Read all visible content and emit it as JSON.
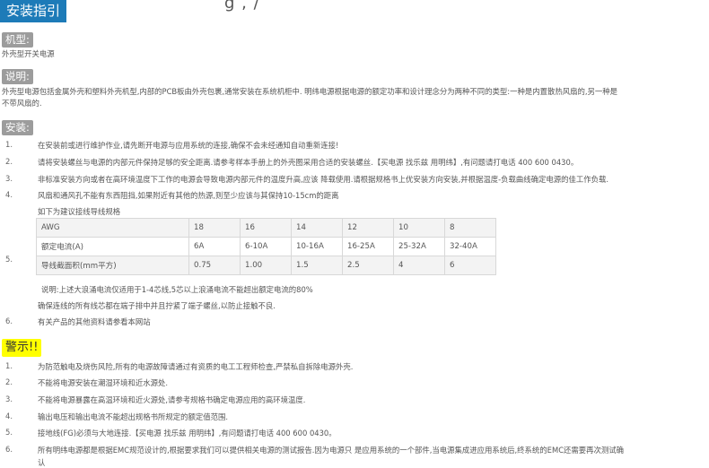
{
  "header": {
    "title": "安装指引",
    "top_clip": "g ,  /"
  },
  "model": {
    "label": "机型:",
    "value": "外壳型开关电源"
  },
  "description": {
    "label": "说明:",
    "line1": "外壳型电源包括金属外壳和塑料外壳机型,内部的PCB板由外壳包裹,通常安装在系统机柜中. 明纬电源根据电源的额定功率和设计理念分为两种不同的类型:一种是内置散热风扇的,另一种是",
    "line2": "不带风扇的."
  },
  "install": {
    "label": "安装:",
    "items": [
      {
        "num": "1.",
        "text": "在安装前或进行维护作业,请先断开电源与应用系统的连接,确保不会未经通知自动重新连接!"
      },
      {
        "num": "2.",
        "text": "请将安装螺丝与电源的内部元件保持足够的安全距离.请参考样本手册上的外壳图采用合适的安装螺丝.【买电源 找乐兹 用明纬】,有问题请打电话 400 600 0430。"
      },
      {
        "num": "3.",
        "text": "非标准安装方向或者在高环境温度下工作的电源会导致电源内部元件的温度升高,应该 降载使用.请根据规格书上优安装方向安装,并根据温度-负载曲线确定电源的佳工作负载."
      },
      {
        "num": "4.",
        "text": "风扇和通风孔不能有东西阻挡,如果附近有其他的热源,则至少应该与其保持10-15cm的距离"
      }
    ],
    "item5": {
      "num": "5.",
      "intro": "如下为建议接线导线规格",
      "note": "说明:上述大浪涌电流仅适用于1-4芯线,5芯以上浪涌电流不能超出额定电流的80%",
      "confirm": "确保连线的所有线芯都在端子排中并且拧紧了端子螺丝,以防止接触不良."
    },
    "table": {
      "rows": [
        [
          "AWG",
          "18",
          "16",
          "14",
          "12",
          "10",
          "8"
        ],
        [
          "额定电流(A)",
          "6A",
          "6-10A",
          "10-16A",
          "16-25A",
          "25-32A",
          "32-40A"
        ],
        [
          "导线截面积(mm平方)",
          "0.75",
          "1.00",
          "1.5",
          "2.5",
          "4",
          "6"
        ]
      ]
    },
    "item6": {
      "num": "6.",
      "text": "有关产品的其他资料请参看本网站"
    }
  },
  "warning": {
    "label": "警示!!",
    "items": [
      {
        "num": "1.",
        "text": "为防范触电及烧伤风险,所有的电源故障请通过有资质的电工工程师检查,严禁私自拆除电源外壳."
      },
      {
        "num": "2.",
        "text": "不能将电源安装在潮湿环境和近水源处."
      },
      {
        "num": "3.",
        "text": "不能将电源暴露在高温环境和近火源处,请参考规格书确定电源应用的高环境温度."
      },
      {
        "num": "4.",
        "text": "输出电压和输出电流不能超出规格书所规定的额定值范围."
      },
      {
        "num": "5.",
        "text": "接地线(FG)必须与大地连接.【买电源 找乐兹 用明纬】,有问题请打电话 400 600 0430。"
      },
      {
        "num": "6.",
        "text": "所有明纬电源都是根据EMC规范设计的,根据要求我们可以提供相关电源的测试报告.因为电源只 是应用系统的一个部件,当电源集成进应用系统后,终系统的EMC还需要再次测试确",
        "text2": "认"
      }
    ]
  }
}
